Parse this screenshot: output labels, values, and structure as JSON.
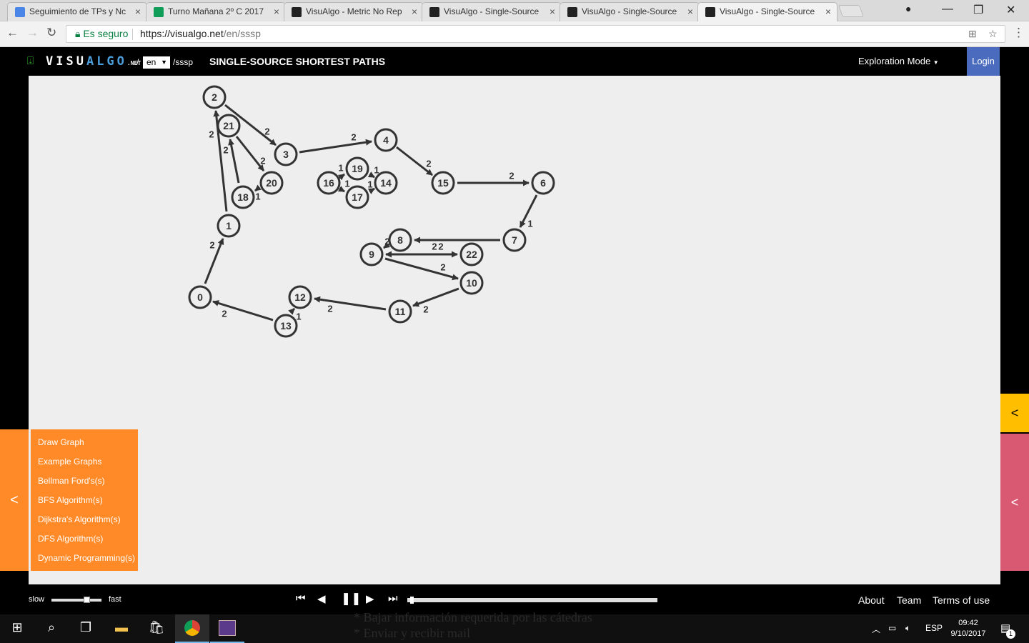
{
  "browser": {
    "tabs": [
      {
        "title": "Seguimiento de TPs y Nc",
        "favicon_color": "#4a86e8"
      },
      {
        "title": "Turno Mañana 2º C 2017",
        "favicon_color": "#0f9d58"
      },
      {
        "title": "VisuAlgo - Metric No Rep",
        "favicon_color": "#222222"
      },
      {
        "title": "VisuAlgo - Single-Source",
        "favicon_color": "#222222"
      },
      {
        "title": "VisuAlgo - Single-Source",
        "favicon_color": "#222222"
      },
      {
        "title": "VisuAlgo - Single-Source",
        "favicon_color": "#222222"
      }
    ],
    "close_glyph": "×",
    "secure_label": "Es seguro",
    "url_host": "https://visualgo.net",
    "url_path": "/en/sssp"
  },
  "header": {
    "logo_visu": "VISU",
    "logo_algo": "ALGO",
    "logo_net": ".NET",
    "slash": "/",
    "lang": "en",
    "path": "/sssp",
    "title": "SINGLE-SOURCE SHORTEST PATHS",
    "mode": "Exploration Mode",
    "login": "Login"
  },
  "graph": {
    "vertices": [
      "0",
      "1",
      "2",
      "3",
      "4",
      "15",
      "6",
      "7",
      "8",
      "9",
      "22",
      "10",
      "11",
      "12",
      "13",
      "21",
      "18",
      "20",
      "16",
      "19",
      "17",
      "14"
    ],
    "edge_weights": [
      "2",
      "2",
      "2",
      "2",
      "2",
      "2",
      "2",
      "1",
      "2",
      "2",
      "2",
      "2",
      "2",
      "1",
      "2",
      "2",
      "2",
      "1",
      "1",
      "1",
      "1",
      "1"
    ]
  },
  "menu": {
    "toggle_icon": "<",
    "items": [
      "Draw Graph",
      "Example Graphs",
      "Bellman Ford's(s)",
      "BFS Algorithm(s)",
      "Dijkstra's Algorithm(s)",
      "DFS Algorithm(s)",
      "Dynamic Programming(s)"
    ]
  },
  "right_panels": {
    "icon1": "<",
    "icon2": "<"
  },
  "controls": {
    "slow": "slow",
    "fast": "fast",
    "speed_fraction": 0.7,
    "progress_fraction": 0.01
  },
  "footer": {
    "about": "About",
    "team": "Team",
    "terms": "Terms of use"
  },
  "taskbar": {
    "ghost_line1": "* Bajar información requerida por las cátedras",
    "ghost_line2": "* Enviar y recibir mail",
    "lang": "ESP",
    "time": "09:42",
    "date": "9/10/2017",
    "notification_count": "1"
  },
  "colors": {
    "menu_orange": "#ff8a27",
    "login_blue": "#4b6bbf",
    "panel_yellow": "#ffbf00",
    "panel_pink": "#d95973"
  }
}
